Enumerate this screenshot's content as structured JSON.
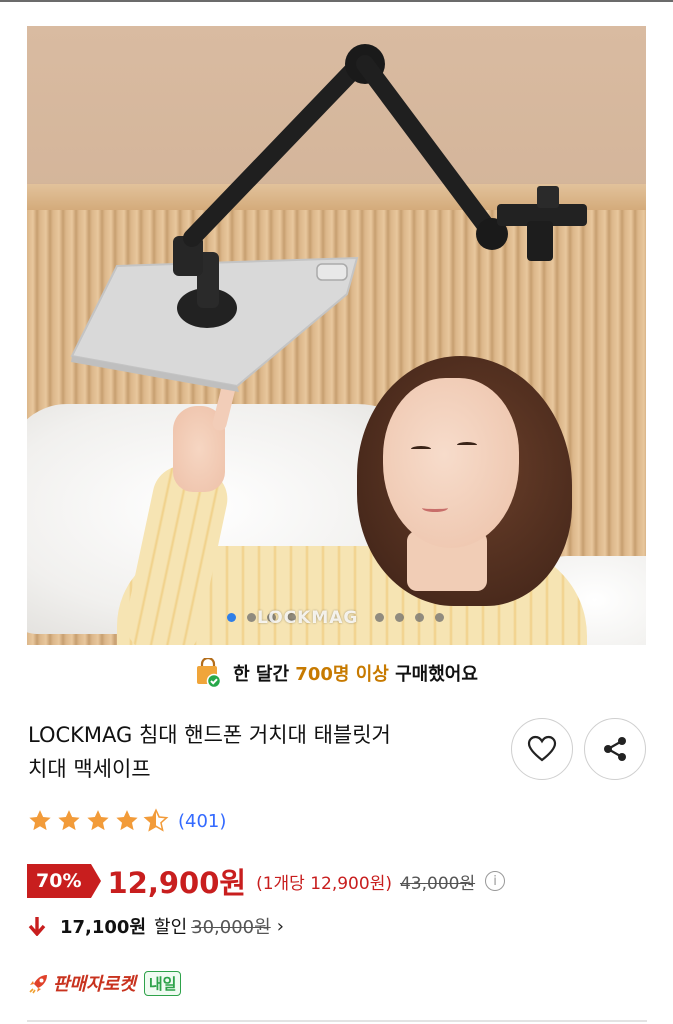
{
  "image": {
    "watermark": "LOCKMAG",
    "carousel": {
      "total": 8,
      "active": 1
    }
  },
  "banner": {
    "text_prefix": "한 달간 ",
    "text_highlight": "700명 이상",
    "text_suffix": " 구매했어요",
    "highlight_color": "#c77a00"
  },
  "product": {
    "title_line1": "LOCKMAG 침대 핸드폰 거치대 태블릿거",
    "title_line2": "치대 맥세이프"
  },
  "actions": {
    "wishlist_icon": "heart-icon",
    "share_icon": "share-icon"
  },
  "rating": {
    "stars": 4.5,
    "max_stars": 5,
    "review_count": "(401)",
    "star_color": "#f29b39"
  },
  "price": {
    "discount": "70%",
    "sale_price": "12,900원",
    "unit_price": "(1개당 12,900원)",
    "original_price": "43,000원",
    "info_icon": "info-icon",
    "accent": "#c81e1e"
  },
  "savings": {
    "amount": "17,100원",
    "label": "할인",
    "original": "30,000원",
    "chevron": "›"
  },
  "delivery": {
    "rocket_label": "판매자로켓",
    "badge": "내일",
    "badge_color": "#2ea24a"
  }
}
